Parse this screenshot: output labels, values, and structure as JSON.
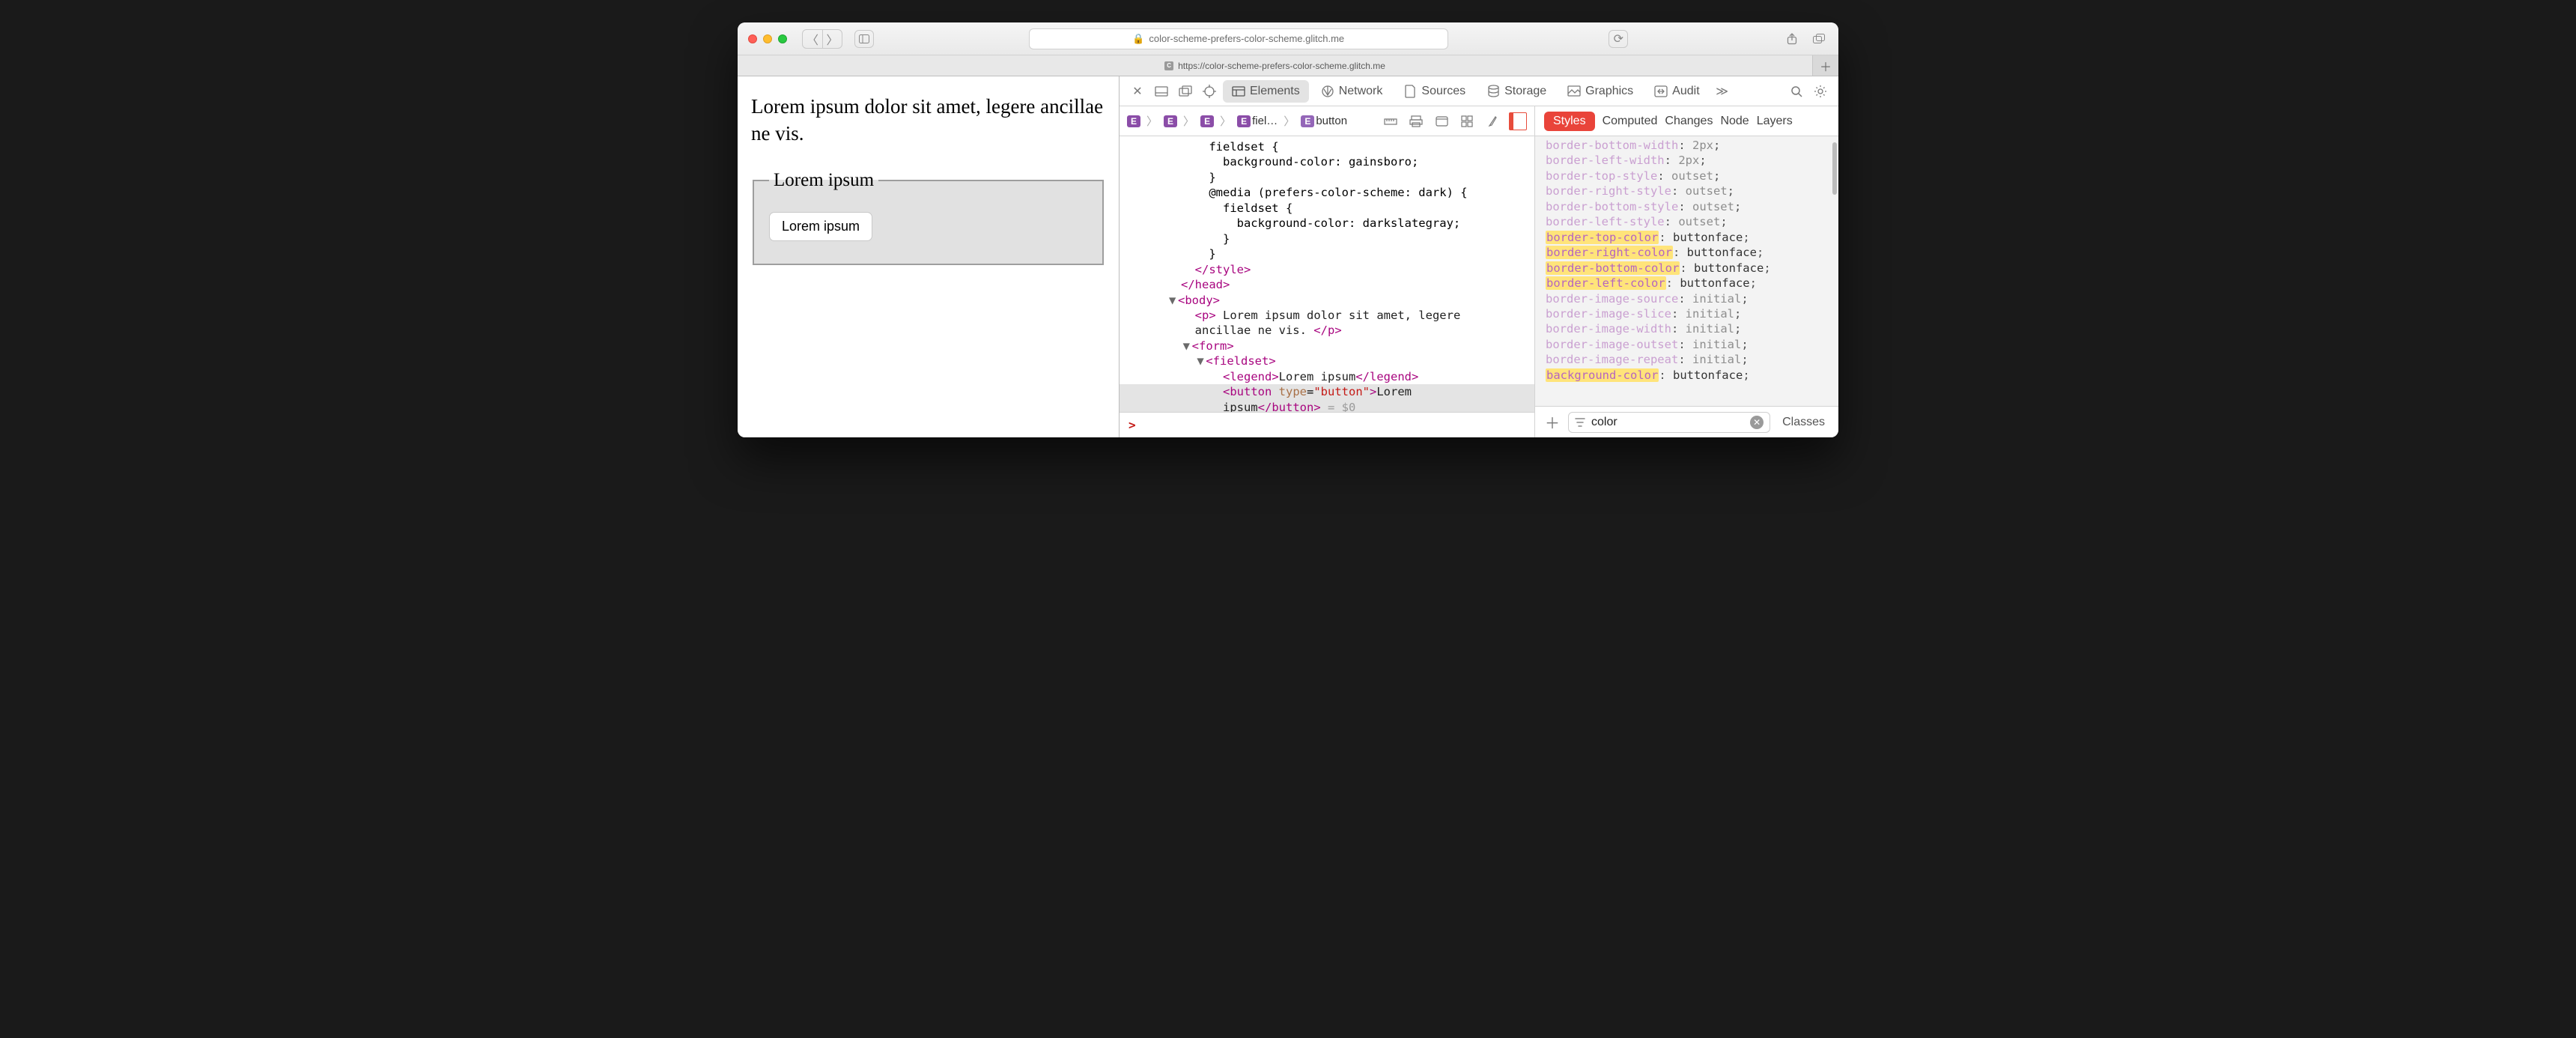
{
  "urlbar": {
    "host": "color-scheme-prefers-color-scheme.glitch.me"
  },
  "tab": {
    "title": "https://color-scheme-prefers-color-scheme.glitch.me",
    "favicon_letter": "C"
  },
  "devtools": {
    "tabs": [
      "Elements",
      "Network",
      "Sources",
      "Storage",
      "Graphics",
      "Audit"
    ],
    "active_tab": "Elements"
  },
  "breadcrumbs": {
    "items": [
      {
        "badge": "E",
        "label": ""
      },
      {
        "badge": "E",
        "label": ""
      },
      {
        "badge": "E",
        "label": ""
      },
      {
        "badge": "E",
        "label": "fiel…"
      },
      {
        "badge": "E",
        "label": "button"
      }
    ]
  },
  "dom_lines": [
    {
      "indent": 5,
      "html": "fieldset {"
    },
    {
      "indent": 6,
      "html": "background-color: gainsboro;"
    },
    {
      "indent": 5,
      "html": "}"
    },
    {
      "indent": 5,
      "html": "@media (prefers-color-scheme: dark) {"
    },
    {
      "indent": 6,
      "html": "fieldset {"
    },
    {
      "indent": 7,
      "html": "background-color: darkslategray;"
    },
    {
      "indent": 6,
      "html": "}"
    },
    {
      "indent": 5,
      "html": "}"
    },
    {
      "indent": 4,
      "html": "<span class='punct'>&lt;/</span><span class='tag'>style</span><span class='punct'>&gt;</span>"
    },
    {
      "indent": 3,
      "html": "<span class='punct'>&lt;/</span><span class='tag'>head</span><span class='punct'>&gt;</span>"
    },
    {
      "indent": 3,
      "html": "<span class='tri'>▼</span><span class='punct'>&lt;</span><span class='tag'>body</span><span class='punct'>&gt;</span>"
    },
    {
      "indent": 4,
      "html": "<span class='punct'>&lt;</span><span class='tag'>p</span><span class='punct'>&gt;</span><span class='txt'> Lorem ipsum dolor sit amet, legere</span>"
    },
    {
      "indent": 4,
      "html": "<span class='txt'>ancillae ne vis. </span><span class='punct'>&lt;/</span><span class='tag'>p</span><span class='punct'>&gt;</span>"
    },
    {
      "indent": 4,
      "html": "<span class='tri'>▼</span><span class='punct'>&lt;</span><span class='tag'>form</span><span class='punct'>&gt;</span>"
    },
    {
      "indent": 5,
      "html": "<span class='tri'>▼</span><span class='punct'>&lt;</span><span class='tag'>fieldset</span><span class='punct'>&gt;</span>"
    },
    {
      "indent": 6,
      "html": "<span class='punct'>&lt;</span><span class='tag'>legend</span><span class='punct'>&gt;</span><span class='txt'>Lorem ipsum</span><span class='punct'>&lt;/</span><span class='tag'>legend</span><span class='punct'>&gt;</span>"
    },
    {
      "indent": 6,
      "sel": true,
      "html": "<span class='punct'>&lt;</span><span class='tag'>button</span> <span class='attr'>type</span>=<span class='val'>\"button\"</span><span class='punct'>&gt;</span><span class='txt'>Lorem</span>"
    },
    {
      "indent": 6,
      "sel": true,
      "html": "<span class='txt'>ipsum</span><span class='punct'>&lt;/</span><span class='tag'>button</span><span class='punct'>&gt;</span> <span class='dim'>= $0</span>"
    }
  ],
  "page": {
    "paragraph": "Lorem ipsum dolor sit amet, legere ancillae ne vis.",
    "legend": "Lorem ipsum",
    "button": "Lorem ipsum"
  },
  "styles": {
    "tabs": [
      "Styles",
      "Computed",
      "Changes",
      "Node",
      "Layers"
    ],
    "filter_value": "color",
    "classes_label": "Classes",
    "props": [
      {
        "name": "border-bottom-width",
        "value": "2px",
        "dim": true
      },
      {
        "name": "border-left-width",
        "value": "2px",
        "dim": true
      },
      {
        "name": "border-top-style",
        "value": "outset",
        "dim": true
      },
      {
        "name": "border-right-style",
        "value": "outset",
        "dim": true
      },
      {
        "name": "border-bottom-style",
        "value": "outset",
        "dim": true
      },
      {
        "name": "border-left-style",
        "value": "outset",
        "dim": true
      },
      {
        "name": "border-top-color",
        "value": "buttonface",
        "hl": true
      },
      {
        "name": "border-right-color",
        "value": "buttonface",
        "hl": true
      },
      {
        "name": "border-bottom-color",
        "value": "buttonface",
        "hl": true
      },
      {
        "name": "border-left-color",
        "value": "buttonface",
        "hl": true
      },
      {
        "name": "border-image-source",
        "value": "initial",
        "dim": true
      },
      {
        "name": "border-image-slice",
        "value": "initial",
        "dim": true
      },
      {
        "name": "border-image-width",
        "value": "initial",
        "dim": true
      },
      {
        "name": "border-image-outset",
        "value": "initial",
        "dim": true
      },
      {
        "name": "border-image-repeat",
        "value": "initial",
        "dim": true
      },
      {
        "name": "background-color",
        "value": "buttonface",
        "hl": true
      }
    ]
  },
  "console_prompt": ">"
}
